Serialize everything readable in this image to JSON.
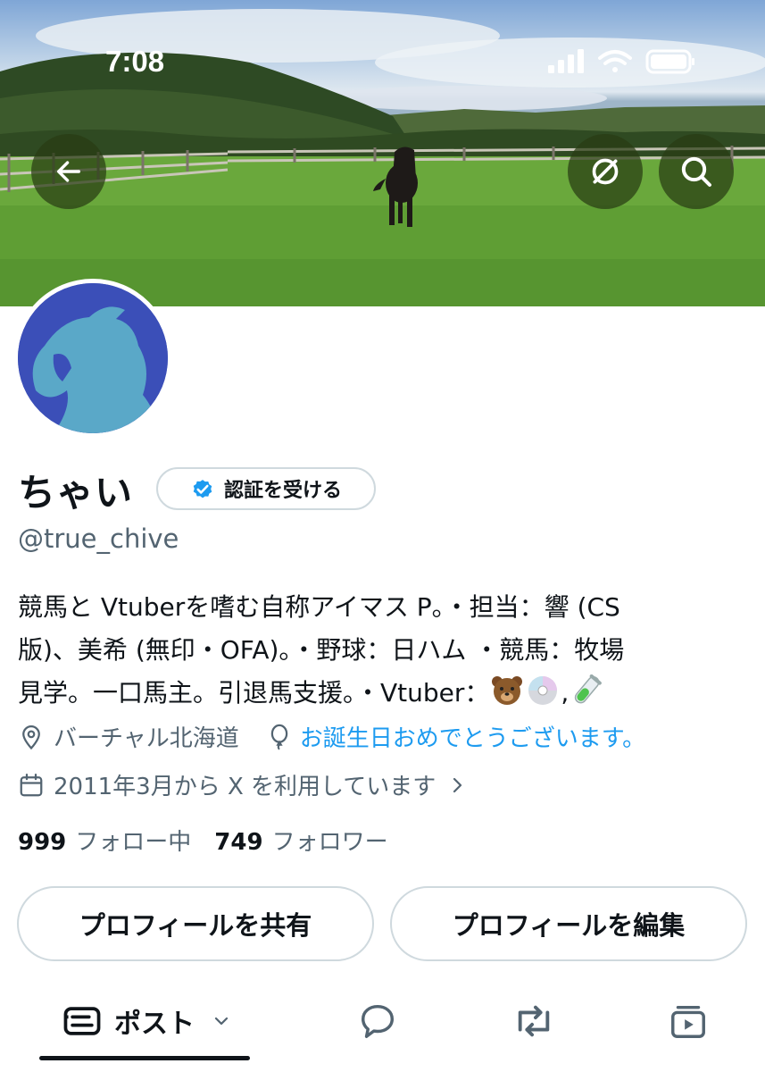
{
  "status_bar": {
    "time": "7:08"
  },
  "header": {
    "back_icon": "arrow-left-icon",
    "grok_icon": "grok-icon",
    "search_icon": "search-icon"
  },
  "profile": {
    "display_name": "ちゃい",
    "verify_button_label": "認証を受ける",
    "handle": "@true_chive",
    "bio_lines": [
      "競馬と Vtuberを嗜む自称アイマス P。・担当：響 (CS",
      "版)、美希 (無印・OFA)。・野球：日ハム ・競馬：牧場",
      "見学。一口馬主。引退馬支援。・Vtuber："
    ],
    "bio_separator": ",",
    "location": "バーチャル北海道",
    "birthday": "お誕生日おめでとうございます。",
    "joined": "2011年3月から X を利用しています"
  },
  "stats": {
    "following_count": "999",
    "following_label": "フォロー中",
    "followers_count": "749",
    "followers_label": "フォロワー"
  },
  "actions": {
    "share_label": "プロフィールを共有",
    "edit_label": "プロフィールを編集"
  },
  "tabs": {
    "posts_label": "ポスト"
  },
  "colors": {
    "accent": "#1d9bf0",
    "text_primary": "#0f1419",
    "text_secondary": "#536471",
    "border": "#cfd9de",
    "avatar_bg": "#3b4fb8"
  }
}
